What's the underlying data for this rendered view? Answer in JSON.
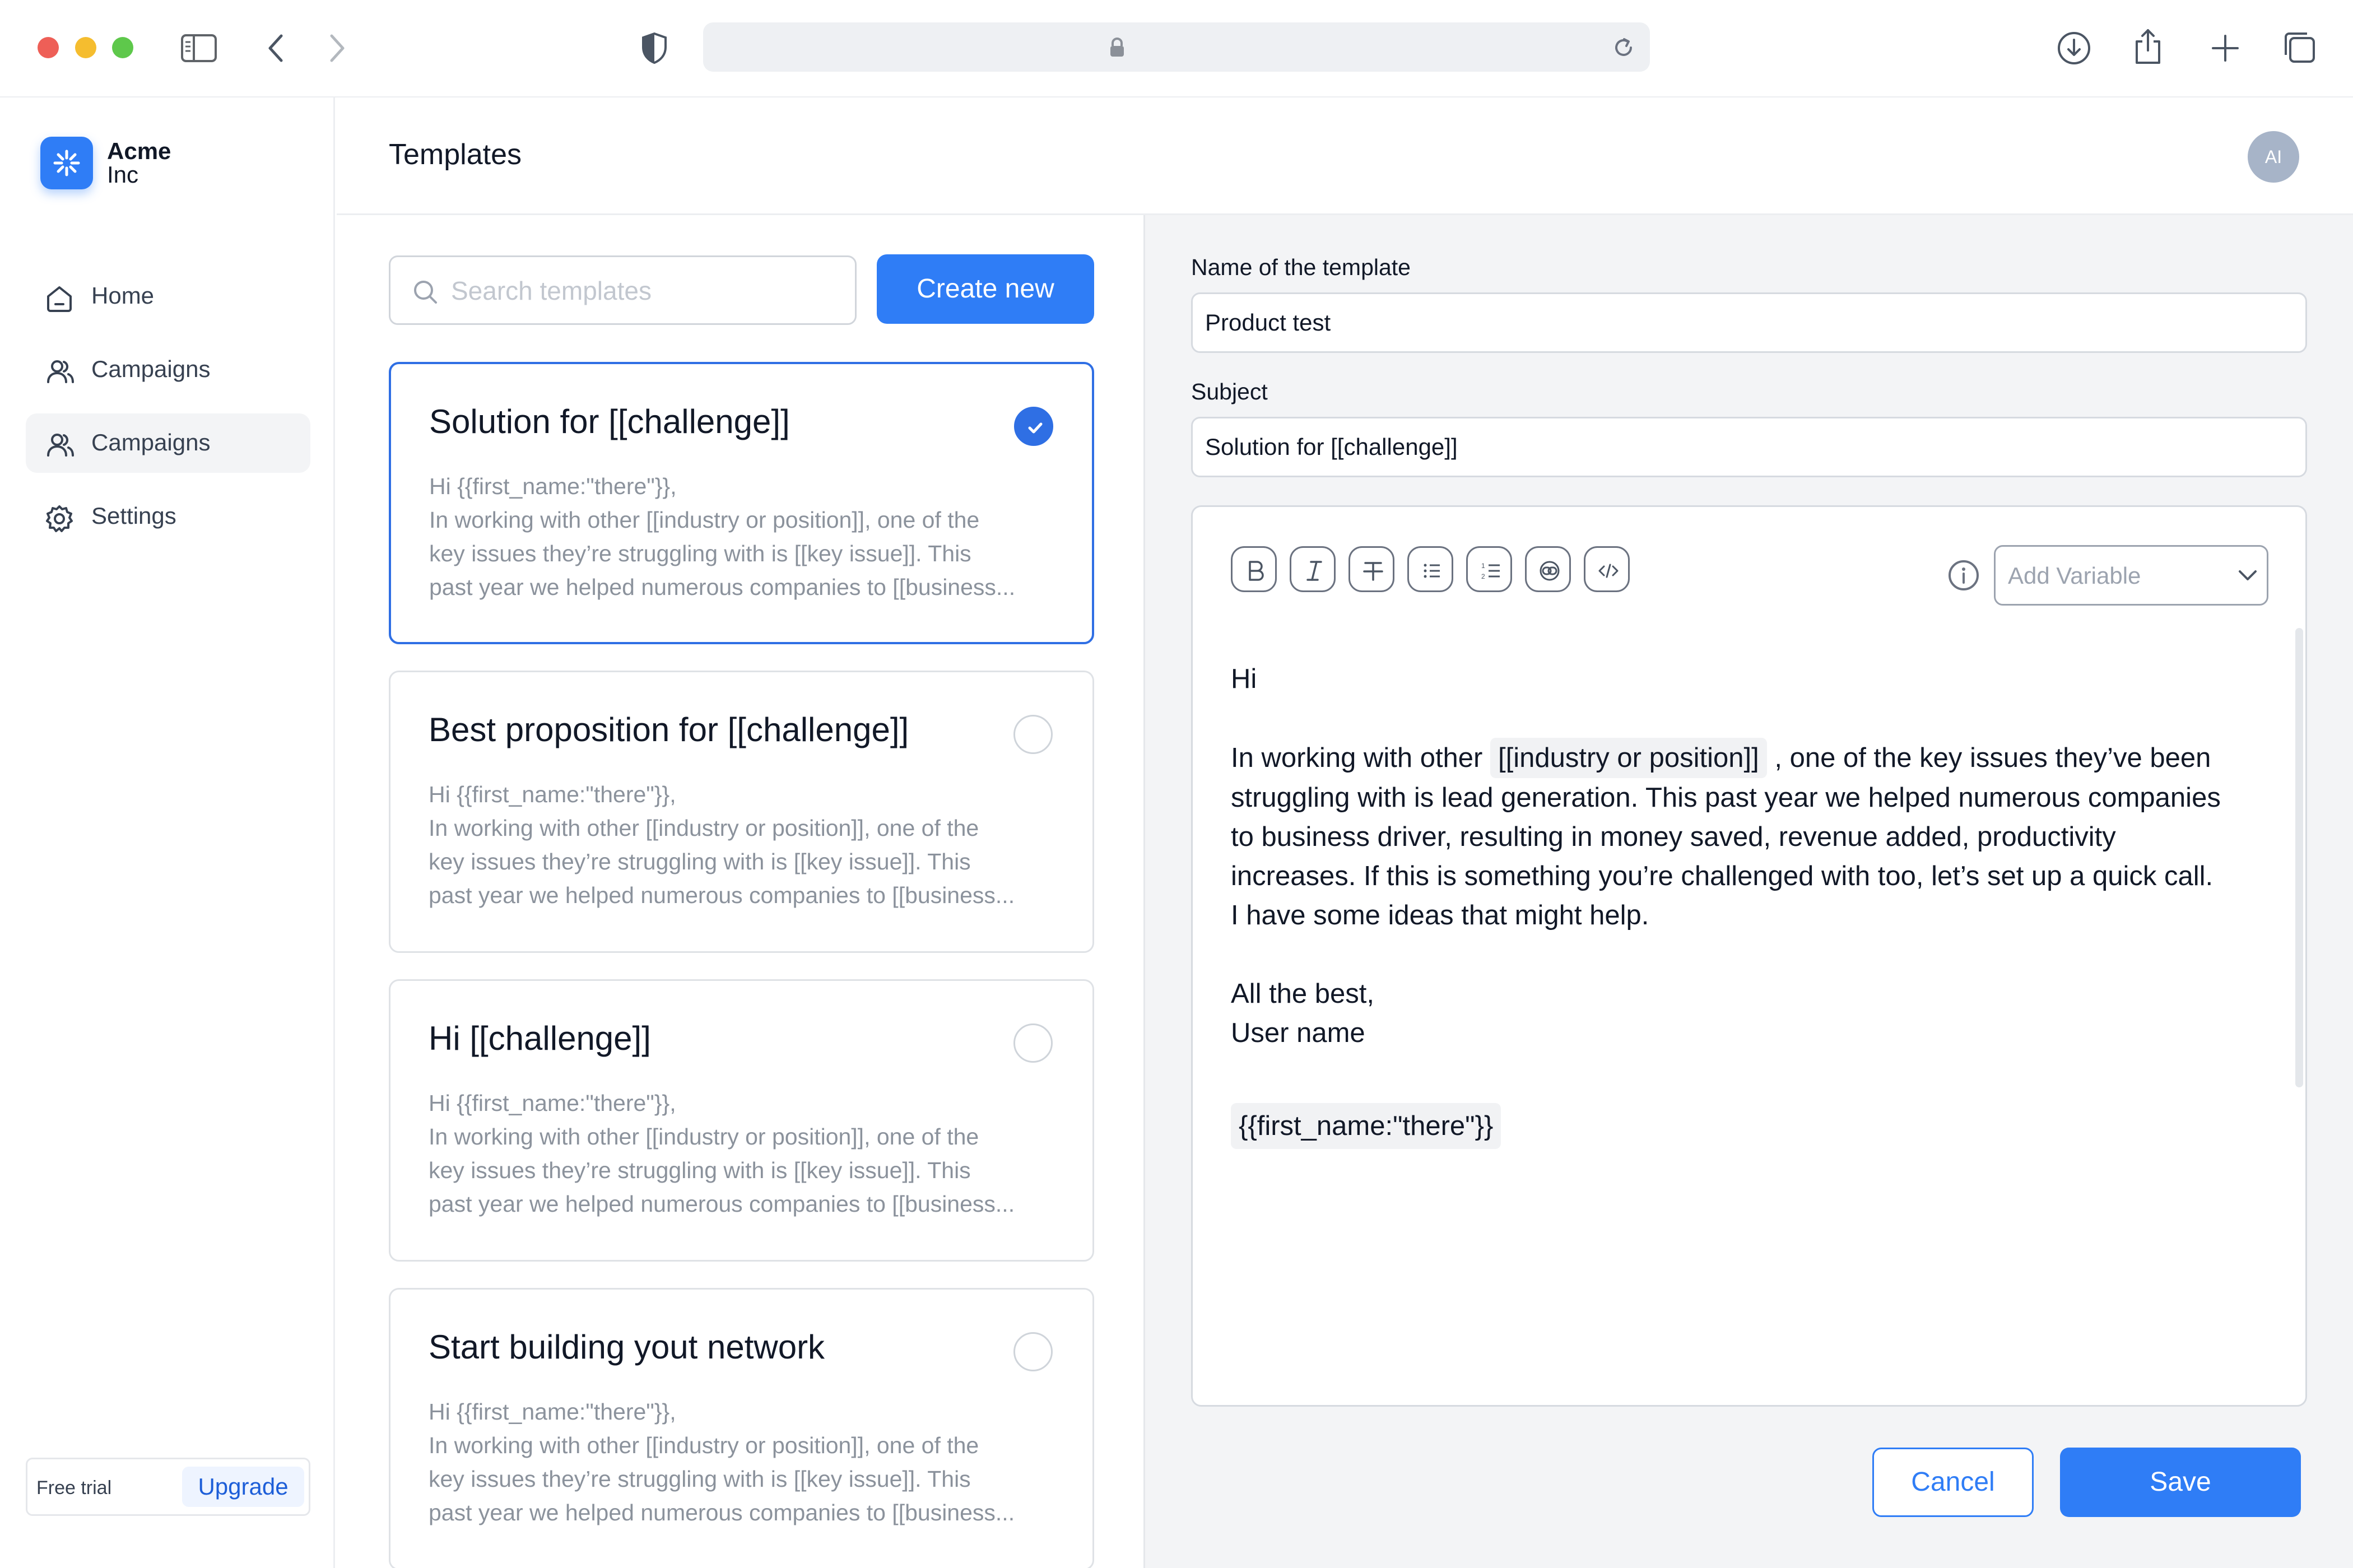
{
  "brand": {
    "name_line1": "Acme",
    "name_line2": "Inc"
  },
  "sidebar": {
    "items": [
      {
        "label": "Home",
        "icon": "home-icon",
        "active": false
      },
      {
        "label": "Campaigns",
        "icon": "users-icon",
        "active": false
      },
      {
        "label": "Campaigns",
        "icon": "users-icon",
        "active": true
      },
      {
        "label": "Settings",
        "icon": "gear-icon",
        "active": false
      }
    ],
    "trial": {
      "text": "Free trial",
      "upgrade_label": "Upgrade"
    }
  },
  "header": {
    "title": "Templates",
    "avatar_initials": "AI"
  },
  "search": {
    "placeholder": "Search templates",
    "value": ""
  },
  "create_label": "Create new",
  "templates": [
    {
      "title": "Solution for [[challenge]]",
      "selected": true,
      "lines": [
        "Hi {{first_name:\"there\"}},",
        "In working with other [[industry or position]], one of the",
        "key issues they’re struggling with is [[key issue]]. This",
        "past year we helped numerous companies to [[business..."
      ]
    },
    {
      "title": "Best proposition for [[challenge]]",
      "selected": false,
      "lines": [
        "Hi {{first_name:\"there\"}},",
        "In working with other [[industry or position]], one of the",
        "key issues they’re struggling with is [[key issue]]. This",
        "past year we helped numerous companies to [[business..."
      ]
    },
    {
      "title": "Hi [[challenge]]",
      "selected": false,
      "lines": [
        "Hi {{first_name:\"there\"}},",
        "In working with other [[industry or position]], one of the",
        "key issues they’re struggling with is [[key issue]]. This",
        "past year we helped numerous companies to [[business..."
      ]
    },
    {
      "title": "Start building yout network",
      "selected": false,
      "lines": [
        "Hi {{first_name:\"there\"}},",
        "In working with other [[industry or position]], one of the",
        "key issues they’re struggling with is [[key issue]]. This",
        "past year we helped numerous companies to [[business..."
      ]
    }
  ],
  "editor": {
    "name_label": "Name of the template",
    "name_value": "Product test",
    "subject_label": "Subject",
    "subject_value": "Solution for [[challenge]]",
    "toolbar": [
      "bold-icon",
      "italic-icon",
      "strikethrough-icon",
      "bullet-list-icon",
      "numbered-list-icon",
      "link-icon",
      "code-icon"
    ],
    "variable_placeholder": "Add Variable",
    "body": {
      "greeting": "Hi",
      "p1_before": "In working with other",
      "p1_chip": "[[industry or position]]",
      "p1_after": ", one of the key issues they’ve been",
      "p1_line2": "struggling with is lead generation. This past year we helped numerous companies",
      "p1_line3": "to business driver, resulting in money saved, revenue added, productivity",
      "p1_line4": "increases. If this is something you’re challenged with too, let’s set up a quick call.",
      "p1_line5": "I have some ideas that might help.",
      "closing": "All the best,",
      "signature": "User name",
      "variable_chip": "{{first_name:\"there\"}}"
    },
    "cancel_label": "Cancel",
    "save_label": "Save"
  },
  "colors": {
    "accent": "#2f7df6",
    "selected_border": "#2f6fe4",
    "panel_bg": "#f3f4f6"
  }
}
